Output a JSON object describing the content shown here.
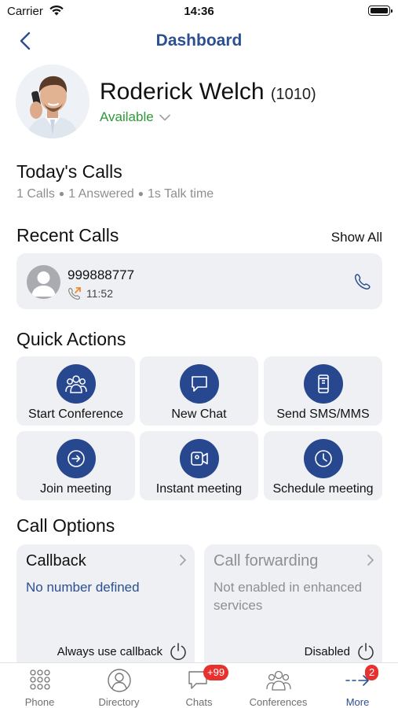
{
  "status_bar": {
    "carrier": "Carrier",
    "time": "14:36"
  },
  "nav": {
    "title": "Dashboard"
  },
  "profile": {
    "name": "Roderick Welch",
    "extension": "(1010)",
    "status": "Available"
  },
  "todays_calls": {
    "heading": "Today's Calls",
    "calls": "1 Calls",
    "answered": "1 Answered",
    "talk_time": "1s Talk time"
  },
  "recent_calls": {
    "heading": "Recent Calls",
    "show_all": "Show All",
    "items": [
      {
        "number": "999888777",
        "time": "11:52",
        "direction_icon": "outgoing-call-icon"
      }
    ]
  },
  "quick_actions": {
    "heading": "Quick Actions",
    "items": [
      {
        "label": "Start Conference",
        "icon": "conference-icon"
      },
      {
        "label": "New Chat",
        "icon": "chat-icon"
      },
      {
        "label": "Send SMS/MMS",
        "icon": "mobile-icon"
      },
      {
        "label": "Join meeting",
        "icon": "join-icon"
      },
      {
        "label": "Instant meeting",
        "icon": "video-icon"
      },
      {
        "label": "Schedule meeting",
        "icon": "clock-icon"
      }
    ]
  },
  "call_options": {
    "heading": "Call Options",
    "callback": {
      "title": "Callback",
      "description": "No number defined",
      "footer": "Always use callback"
    },
    "forwarding": {
      "title": "Call forwarding",
      "description": "Not enabled in enhanced services",
      "footer": "Disabled"
    }
  },
  "tabs": [
    {
      "label": "Phone",
      "icon": "keypad-icon"
    },
    {
      "label": "Directory",
      "icon": "directory-icon"
    },
    {
      "label": "Chats",
      "icon": "chats-icon",
      "badge": "+99"
    },
    {
      "label": "Conferences",
      "icon": "conferences-icon"
    },
    {
      "label": "More",
      "icon": "more-icon",
      "badge": "2",
      "active": true
    }
  ],
  "colors": {
    "accent": "#2c4f8f",
    "action_circle": "#27478f",
    "available": "#2e9a3a",
    "card_bg": "#eef0f3",
    "badge": "#e8312e"
  }
}
